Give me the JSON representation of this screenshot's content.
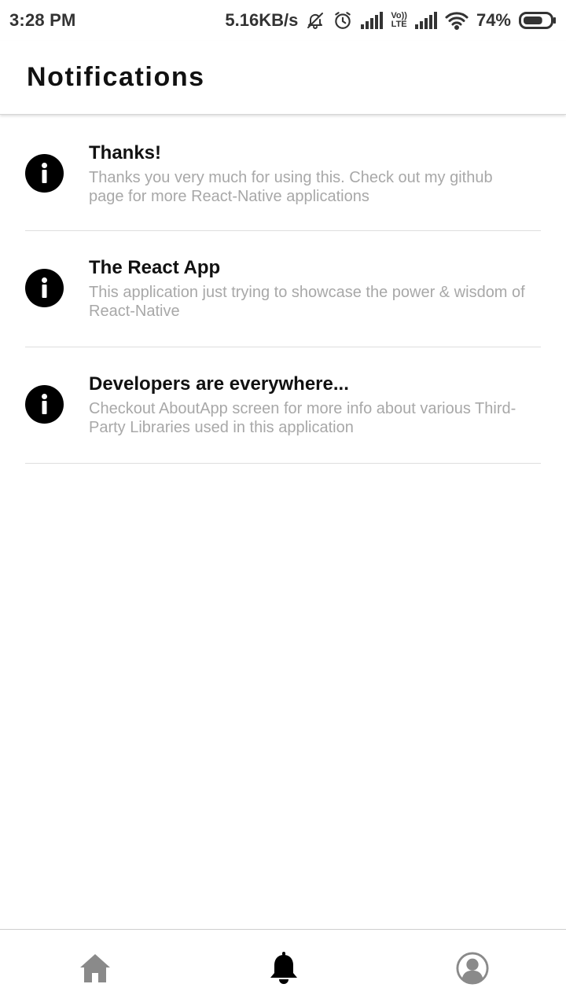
{
  "status_bar": {
    "time": "3:28 PM",
    "network_speed": "5.16KB/s",
    "volte_label_top": "Vo))",
    "volte_label_bottom": "LTE",
    "battery_percent": "74%",
    "battery_level": 0.74,
    "icons": [
      "bell-off-icon",
      "alarm-icon",
      "signal-icon",
      "volte-icon",
      "signal-icon",
      "wifi-icon",
      "battery-icon"
    ]
  },
  "header": {
    "title": "Notifications"
  },
  "notifications": [
    {
      "icon": "info-icon",
      "title": "Thanks!",
      "body": "Thanks you very much for using this. Check out my github page for more React-Native applications"
    },
    {
      "icon": "info-icon",
      "title": "The React App",
      "body": "This application just trying to showcase the power & wisdom of React-Native"
    },
    {
      "icon": "info-icon",
      "title": "Developers are everywhere...",
      "body": "Checkout AboutApp screen for more info about various Third-Party Libraries used in this application"
    }
  ],
  "tab_bar": {
    "tabs": [
      {
        "icon": "home-icon",
        "active": false
      },
      {
        "icon": "bell-icon",
        "active": true
      },
      {
        "icon": "profile-icon",
        "active": false
      }
    ],
    "colors": {
      "active": "#000000",
      "inactive": "#8a8a8a"
    }
  }
}
